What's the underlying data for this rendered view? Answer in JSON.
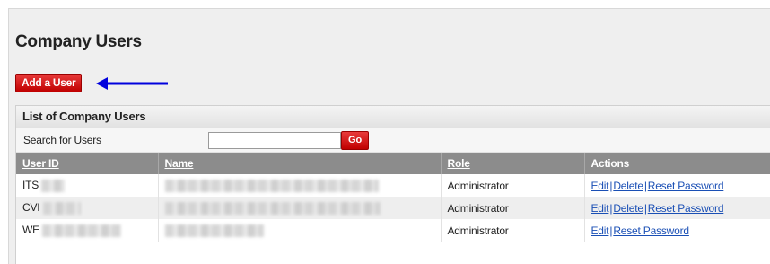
{
  "page": {
    "title": "Company Users",
    "add_button_label": "Add a User",
    "arrow_color": "#0000dd",
    "arrow_icon": "left-arrow"
  },
  "list": {
    "header": "List of Company Users",
    "search_label": "Search for Users",
    "search_value": "",
    "go_label": "Go",
    "columns": [
      "User ID",
      "Name",
      "Role",
      "Actions"
    ],
    "rows": [
      {
        "user_id_prefix": "ITS",
        "role": "Administrator",
        "actions": [
          "Edit",
          "Delete",
          "Reset Password"
        ]
      },
      {
        "user_id_prefix": "CVI",
        "role": "Administrator",
        "actions": [
          "Edit",
          "Delete",
          "Reset Password"
        ]
      },
      {
        "user_id_prefix": "WE",
        "role": "Administrator",
        "actions": [
          "Edit",
          "Reset Password"
        ]
      }
    ]
  },
  "colors": {
    "accent_red": "#cc0000",
    "table_header_bg": "#8c8c8c",
    "link_blue": "#1a4fb5"
  }
}
